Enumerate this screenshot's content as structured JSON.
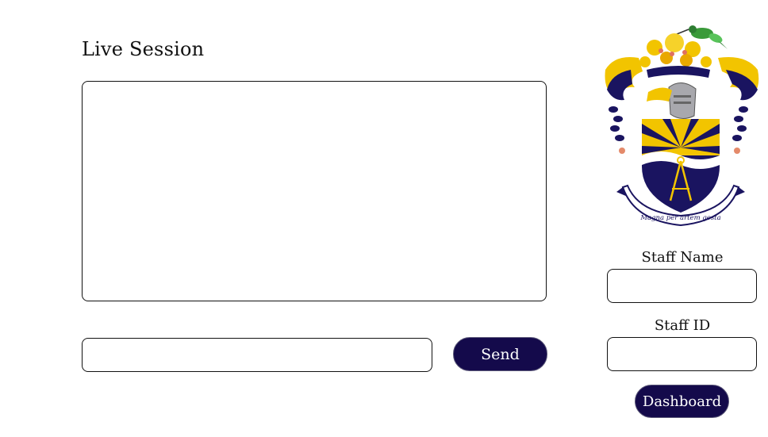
{
  "page": {
    "title": "Live Session"
  },
  "chat": {
    "message_value": "",
    "send_label": "Send"
  },
  "crest": {
    "motto": "Magna per artem gesta"
  },
  "staff": {
    "name_label": "Staff Name",
    "name_value": "",
    "id_label": "Staff ID",
    "id_value": ""
  },
  "nav": {
    "dashboard_label": "Dashboard"
  },
  "colors": {
    "button_bg": "#140a4b",
    "crest_navy": "#1a1460",
    "crest_gold": "#f2c400"
  }
}
